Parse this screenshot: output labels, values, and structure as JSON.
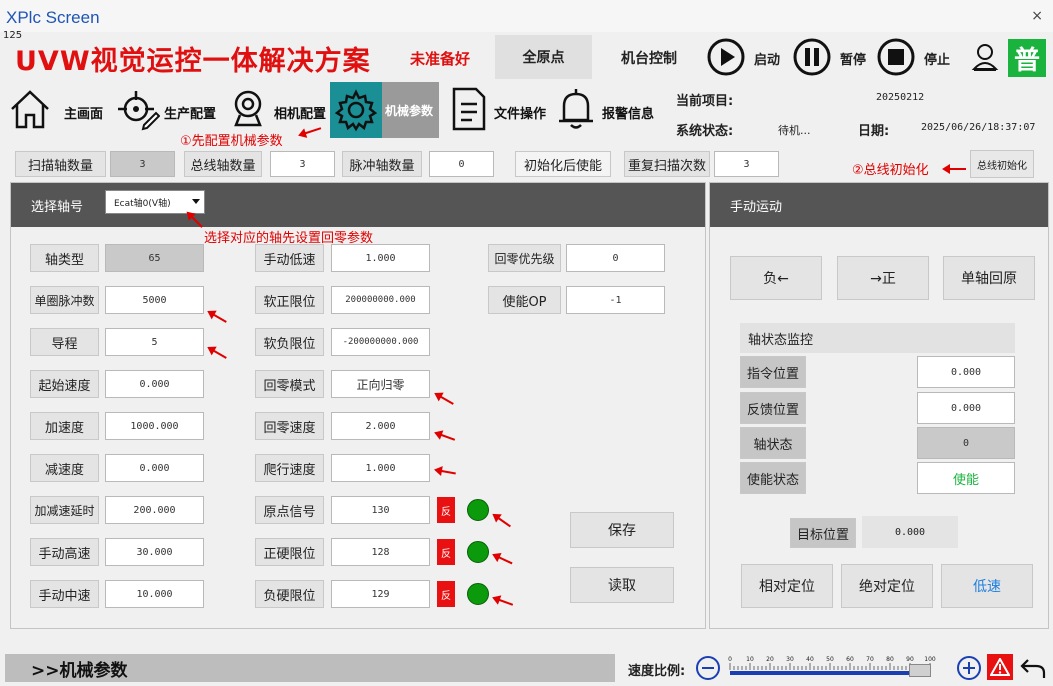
{
  "window": {
    "title": "XPlc Screen",
    "corner_number": "125",
    "close_glyph": "×"
  },
  "header": {
    "app_title": "UVW视觉运控一体解决方案",
    "status_warning": "未准备好",
    "btn_home": "全原点",
    "btn_machine": "机台控制",
    "btn_start": "启动",
    "btn_pause": "暂停",
    "btn_stop": "停止",
    "badge": "普"
  },
  "nav": {
    "items": [
      {
        "label": "主画面",
        "icon": "home-icon"
      },
      {
        "label": "生产配置",
        "icon": "target-pen-icon"
      },
      {
        "label": "相机配置",
        "icon": "camera-icon"
      },
      {
        "label": "机械参数",
        "icon": "gear-icon"
      },
      {
        "label": "文件操作",
        "icon": "file-icon"
      },
      {
        "label": "报警信息",
        "icon": "bell-icon"
      }
    ],
    "current_project_label": "当前项目:",
    "current_project_value": "20250212",
    "system_status_label": "系统状态:",
    "system_status_value": "待机...",
    "date_label": "日期:",
    "date_value": "2025/06/26/18:37:07"
  },
  "annotations": {
    "step1": "①先配置机械参数",
    "step2": "②总线初始化",
    "select_axis_hint": "选择对应的轴先设置回零参数"
  },
  "axis_counts": {
    "scan_label": "扫描轴数量",
    "scan_value": "3",
    "bus_label": "总线轴数量",
    "bus_value": "3",
    "pulse_label": "脉冲轴数量",
    "pulse_value": "0",
    "init_enable_label": "初始化后使能",
    "repeat_scan_label": "重复扫描次数",
    "repeat_scan_value": "3",
    "bus_init_button": "总线初始化"
  },
  "left_panel": {
    "select_axis_label": "选择轴号",
    "selected_axis": "Ecat轴0(V轴)",
    "col1": [
      {
        "label": "轴类型",
        "value": "65",
        "gray": true
      },
      {
        "label": "单圈脉冲数",
        "value": "5000"
      },
      {
        "label": "导程",
        "value": "5"
      },
      {
        "label": "起始速度",
        "value": "0.000"
      },
      {
        "label": "加速度",
        "value": "1000.000"
      },
      {
        "label": "减速度",
        "value": "0.000"
      },
      {
        "label": "加减速延时",
        "value": "200.000"
      },
      {
        "label": "手动高速",
        "value": "30.000"
      },
      {
        "label": "手动中速",
        "value": "10.000"
      }
    ],
    "col2": [
      {
        "label": "手动低速",
        "value": "1.000"
      },
      {
        "label": "软正限位",
        "value": "200000000.000"
      },
      {
        "label": "软负限位",
        "value": "-200000000.000"
      },
      {
        "label": "回零模式",
        "value": "正向归零"
      },
      {
        "label": "回零速度",
        "value": "2.000"
      },
      {
        "label": "爬行速度",
        "value": "1.000"
      },
      {
        "label": "原点信号",
        "value": "130",
        "flag": "反"
      },
      {
        "label": "正硬限位",
        "value": "128",
        "flag": "反"
      },
      {
        "label": "负硬限位",
        "value": "129",
        "flag": "反"
      }
    ],
    "col3": [
      {
        "label": "回零优先级",
        "value": "0"
      },
      {
        "label": "使能OP",
        "value": "-1"
      }
    ],
    "save_button": "保存",
    "read_button": "读取"
  },
  "right_panel": {
    "title": "手动运动",
    "btn_neg": "负←",
    "btn_pos": "→正",
    "btn_single_home": "单轴回原",
    "monitor_title": "轴状态监控",
    "monitor": [
      {
        "label": "指令位置",
        "value": "0.000"
      },
      {
        "label": "反馈位置",
        "value": "0.000"
      },
      {
        "label": "轴状态",
        "value": "0"
      },
      {
        "label": "使能状态",
        "value": "使能"
      }
    ],
    "target_label": "目标位置",
    "target_value": "0.000",
    "btn_relative": "相对定位",
    "btn_absolute": "绝对定位",
    "btn_low_speed": "低速"
  },
  "footer": {
    "breadcrumb": ">>机械参数",
    "speed_ratio_label": "速度比例:",
    "scale_labels": [
      "0",
      "10",
      "20",
      "30",
      "40",
      "50",
      "60",
      "70",
      "80",
      "90",
      "100"
    ],
    "speed_ratio_fraction": 0.95
  },
  "colors": {
    "title_red": "#e01010",
    "accent_teal": "#1a8f95",
    "panel_header": "#555555",
    "badge_green": "#19b33d",
    "enable_green": "#19b33d",
    "low_speed_blue": "#1e7fe0"
  }
}
